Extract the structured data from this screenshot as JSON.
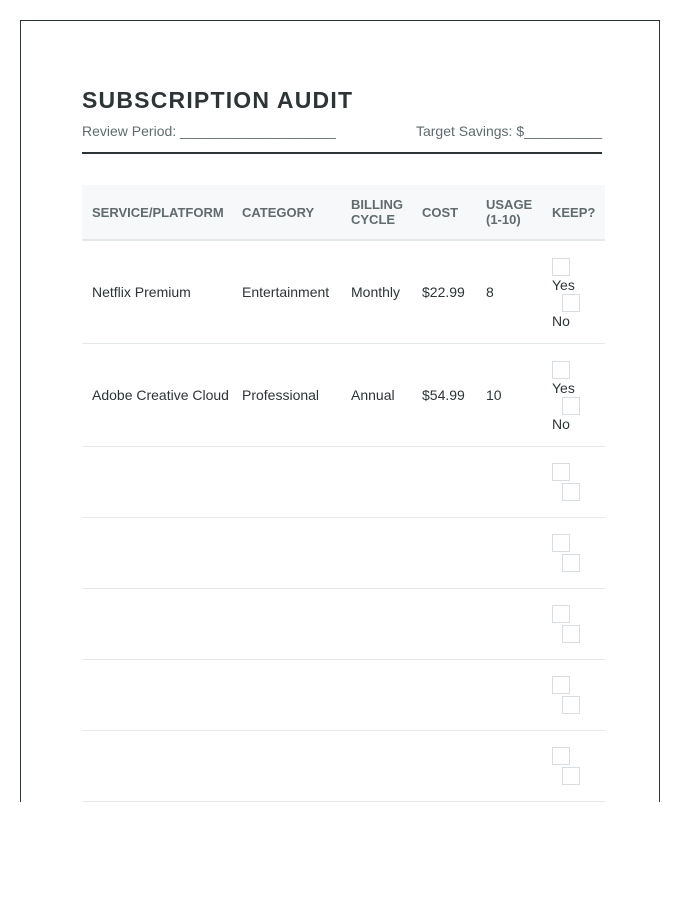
{
  "document": {
    "title": "SUBSCRIPTION AUDIT",
    "review_period_label": "Review Period: ____________________",
    "target_savings_label": "Target Savings: $__________"
  },
  "table": {
    "headers": [
      "SERVICE/PLATFORM",
      "CATEGORY",
      "BILLING CYCLE",
      "COST",
      "USAGE (1-10)",
      "KEEP?"
    ],
    "rows": [
      {
        "service": "Netflix Premium",
        "category": "Entertainment",
        "billing": "Monthly",
        "cost": "$22.99",
        "usage": "8",
        "yes": "Yes",
        "no": "No"
      },
      {
        "service": "Adobe Creative Cloud",
        "category": "Professional",
        "billing": "Annual",
        "cost": "$54.99",
        "usage": "10",
        "yes": "Yes",
        "no": "No"
      }
    ],
    "empty_rows": 5
  }
}
